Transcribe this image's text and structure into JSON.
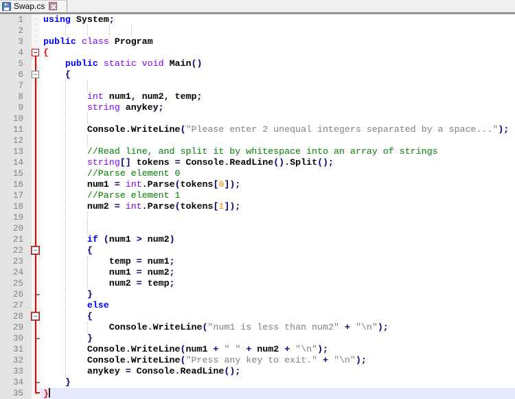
{
  "tab": {
    "title": "Swap.cs"
  },
  "icons": {
    "file_icon": "floppy-disk-saved",
    "close_icon": "close-x"
  },
  "ui_colors": {
    "tabbar_bg": "#f0f0f0",
    "tab_bg": "#f4f4f4",
    "close_bg": "#b98e9a",
    "gutter_bg": "#e4e4e4",
    "line_number": "#808080",
    "curline_bg": "#e8e8ff",
    "fold_line": "#ee0000",
    "fold_box": "#808080"
  },
  "syntax_colors": {
    "keyword": "#0000ff",
    "type": "#8000ff",
    "comment": "#008000",
    "string": "#808080",
    "number": "#ff8000",
    "operator": "#000080",
    "default": "#000000",
    "brace_match": "#ff0000"
  },
  "editor": {
    "caret_line": 35,
    "lines": [
      {
        "n": 1,
        "ind": 0,
        "g": [],
        "t": [
          [
            "k",
            "using"
          ],
          [
            "d",
            " System"
          ],
          [
            "o",
            ";"
          ]
        ]
      },
      {
        "n": 2,
        "ind": 0,
        "g": [
          4,
          8,
          12,
          16
        ],
        "t": []
      },
      {
        "n": 3,
        "ind": 0,
        "g": [],
        "t": [
          [
            "k",
            "public"
          ],
          [
            "d",
            " "
          ],
          [
            "t",
            "class"
          ],
          [
            "d",
            " Program"
          ]
        ]
      },
      {
        "n": 4,
        "ind": 0,
        "g": [],
        "m": "boxred",
        "t": [
          [
            "b",
            "{"
          ]
        ]
      },
      {
        "n": 5,
        "ind": 4,
        "g": [],
        "t": [
          [
            "k",
            "public"
          ],
          [
            "d",
            " "
          ],
          [
            "t",
            "static"
          ],
          [
            "d",
            " "
          ],
          [
            "t",
            "void"
          ],
          [
            "d",
            " Main"
          ],
          [
            "o",
            "()"
          ]
        ]
      },
      {
        "n": 6,
        "ind": 4,
        "g": [],
        "m": "box",
        "t": [
          [
            "o",
            "{"
          ]
        ]
      },
      {
        "n": 7,
        "ind": 0,
        "g": [
          4,
          8
        ],
        "t": []
      },
      {
        "n": 8,
        "ind": 8,
        "g": [
          4
        ],
        "t": [
          [
            "t",
            "int"
          ],
          [
            "d",
            " num1"
          ],
          [
            "o",
            ","
          ],
          [
            "d",
            " num2"
          ],
          [
            "o",
            ","
          ],
          [
            "d",
            " temp"
          ],
          [
            "o",
            ";"
          ]
        ]
      },
      {
        "n": 9,
        "ind": 8,
        "g": [
          4
        ],
        "t": [
          [
            "t",
            "string"
          ],
          [
            "d",
            " anykey"
          ],
          [
            "o",
            ";"
          ]
        ]
      },
      {
        "n": 10,
        "ind": 0,
        "g": [
          4,
          8
        ],
        "t": []
      },
      {
        "n": 11,
        "ind": 8,
        "g": [
          4
        ],
        "t": [
          [
            "d",
            "Console"
          ],
          [
            "o",
            "."
          ],
          [
            "d",
            "WriteLine"
          ],
          [
            "o",
            "("
          ],
          [
            "s",
            "\"Please enter 2 unequal integers separated by a space...\""
          ],
          [
            "o",
            ");"
          ]
        ]
      },
      {
        "n": 12,
        "ind": 0,
        "g": [
          4,
          8
        ],
        "t": []
      },
      {
        "n": 13,
        "ind": 8,
        "g": [
          4
        ],
        "t": [
          [
            "c",
            "//Read line, and split it by whitespace into an array of strings"
          ]
        ]
      },
      {
        "n": 14,
        "ind": 8,
        "g": [
          4
        ],
        "t": [
          [
            "t",
            "string"
          ],
          [
            "o",
            "[]"
          ],
          [
            "d",
            " tokens "
          ],
          [
            "o",
            "="
          ],
          [
            "d",
            " Console"
          ],
          [
            "o",
            "."
          ],
          [
            "d",
            "ReadLine"
          ],
          [
            "o",
            "()."
          ],
          [
            "d",
            "Split"
          ],
          [
            "o",
            "();"
          ]
        ]
      },
      {
        "n": 15,
        "ind": 8,
        "g": [
          4
        ],
        "t": [
          [
            "c",
            "//Parse element 0"
          ]
        ]
      },
      {
        "n": 16,
        "ind": 8,
        "g": [
          4
        ],
        "t": [
          [
            "d",
            "num1 "
          ],
          [
            "o",
            "="
          ],
          [
            "d",
            " "
          ],
          [
            "t",
            "int"
          ],
          [
            "o",
            "."
          ],
          [
            "d",
            "Parse"
          ],
          [
            "o",
            "("
          ],
          [
            "d",
            "tokens"
          ],
          [
            "o",
            "["
          ],
          [
            "n_",
            "0"
          ],
          [
            "o",
            "]);"
          ]
        ]
      },
      {
        "n": 17,
        "ind": 8,
        "g": [
          4
        ],
        "t": [
          [
            "c",
            "//Parse element 1"
          ]
        ]
      },
      {
        "n": 18,
        "ind": 8,
        "g": [
          4
        ],
        "t": [
          [
            "d",
            "num2 "
          ],
          [
            "o",
            "="
          ],
          [
            "d",
            " "
          ],
          [
            "t",
            "int"
          ],
          [
            "o",
            "."
          ],
          [
            "d",
            "Parse"
          ],
          [
            "o",
            "("
          ],
          [
            "d",
            "tokens"
          ],
          [
            "o",
            "["
          ],
          [
            "n_",
            "1"
          ],
          [
            "o",
            "]);"
          ]
        ]
      },
      {
        "n": 19,
        "ind": 0,
        "g": [
          4,
          8
        ],
        "t": []
      },
      {
        "n": 20,
        "ind": 0,
        "g": [
          4,
          8
        ],
        "t": []
      },
      {
        "n": 21,
        "ind": 8,
        "g": [
          4
        ],
        "t": [
          [
            "k",
            "if"
          ],
          [
            "d",
            " "
          ],
          [
            "o",
            "("
          ],
          [
            "d",
            "num1 "
          ],
          [
            "o",
            ">"
          ],
          [
            "d",
            " num2"
          ],
          [
            "o",
            ")"
          ]
        ]
      },
      {
        "n": 22,
        "ind": 8,
        "g": [
          4
        ],
        "m": "boxring",
        "t": [
          [
            "o",
            "{"
          ]
        ]
      },
      {
        "n": 23,
        "ind": 12,
        "g": [
          4,
          8
        ],
        "t": [
          [
            "d",
            "temp "
          ],
          [
            "o",
            "="
          ],
          [
            "d",
            " num1"
          ],
          [
            "o",
            ";"
          ]
        ]
      },
      {
        "n": 24,
        "ind": 12,
        "g": [
          4,
          8
        ],
        "t": [
          [
            "d",
            "num1 "
          ],
          [
            "o",
            "="
          ],
          [
            "d",
            " num2"
          ],
          [
            "o",
            ";"
          ]
        ]
      },
      {
        "n": 25,
        "ind": 12,
        "g": [
          4,
          8
        ],
        "t": [
          [
            "d",
            "num2 "
          ],
          [
            "o",
            "="
          ],
          [
            "d",
            " temp"
          ],
          [
            "o",
            ";"
          ]
        ]
      },
      {
        "n": 26,
        "ind": 8,
        "g": [
          4
        ],
        "m": "tick",
        "t": [
          [
            "o",
            "}"
          ]
        ]
      },
      {
        "n": 27,
        "ind": 8,
        "g": [
          4
        ],
        "t": [
          [
            "k",
            "else"
          ]
        ]
      },
      {
        "n": 28,
        "ind": 8,
        "g": [
          4
        ],
        "m": "boxring",
        "t": [
          [
            "o",
            "{"
          ]
        ]
      },
      {
        "n": 29,
        "ind": 12,
        "g": [
          4,
          8
        ],
        "t": [
          [
            "d",
            "Console"
          ],
          [
            "o",
            "."
          ],
          [
            "d",
            "WriteLine"
          ],
          [
            "o",
            "("
          ],
          [
            "s",
            "\"num1 is less than num2\""
          ],
          [
            "d",
            " "
          ],
          [
            "o",
            "+"
          ],
          [
            "d",
            " "
          ],
          [
            "s",
            "\"\\n\""
          ],
          [
            "o",
            ");"
          ]
        ]
      },
      {
        "n": 30,
        "ind": 8,
        "g": [
          4
        ],
        "m": "tick",
        "t": [
          [
            "o",
            "}"
          ]
        ]
      },
      {
        "n": 31,
        "ind": 8,
        "g": [
          4
        ],
        "t": [
          [
            "d",
            "Console"
          ],
          [
            "o",
            "."
          ],
          [
            "d",
            "WriteLine"
          ],
          [
            "o",
            "("
          ],
          [
            "d",
            "num1 "
          ],
          [
            "o",
            "+"
          ],
          [
            "d",
            " "
          ],
          [
            "s",
            "\" \""
          ],
          [
            "d",
            " "
          ],
          [
            "o",
            "+"
          ],
          [
            "d",
            " num2 "
          ],
          [
            "o",
            "+"
          ],
          [
            "d",
            " "
          ],
          [
            "s",
            "\"\\n\""
          ],
          [
            "o",
            ");"
          ]
        ]
      },
      {
        "n": 32,
        "ind": 8,
        "g": [
          4
        ],
        "t": [
          [
            "d",
            "Console"
          ],
          [
            "o",
            "."
          ],
          [
            "d",
            "WriteLine"
          ],
          [
            "o",
            "("
          ],
          [
            "s",
            "\"Press any key to exit.\""
          ],
          [
            "d",
            " "
          ],
          [
            "o",
            "+"
          ],
          [
            "d",
            " "
          ],
          [
            "s",
            "\"\\n\""
          ],
          [
            "o",
            ");"
          ]
        ]
      },
      {
        "n": 33,
        "ind": 8,
        "g": [
          4
        ],
        "t": [
          [
            "d",
            "anykey "
          ],
          [
            "o",
            "="
          ],
          [
            "d",
            " Console"
          ],
          [
            "o",
            "."
          ],
          [
            "d",
            "ReadLine"
          ],
          [
            "o",
            "();"
          ]
        ]
      },
      {
        "n": 34,
        "ind": 4,
        "g": [],
        "m": "tick",
        "t": [
          [
            "o",
            "}"
          ]
        ]
      },
      {
        "n": 35,
        "ind": 0,
        "g": [],
        "m": "corner",
        "t": [
          [
            "b",
            "}"
          ]
        ]
      }
    ]
  }
}
